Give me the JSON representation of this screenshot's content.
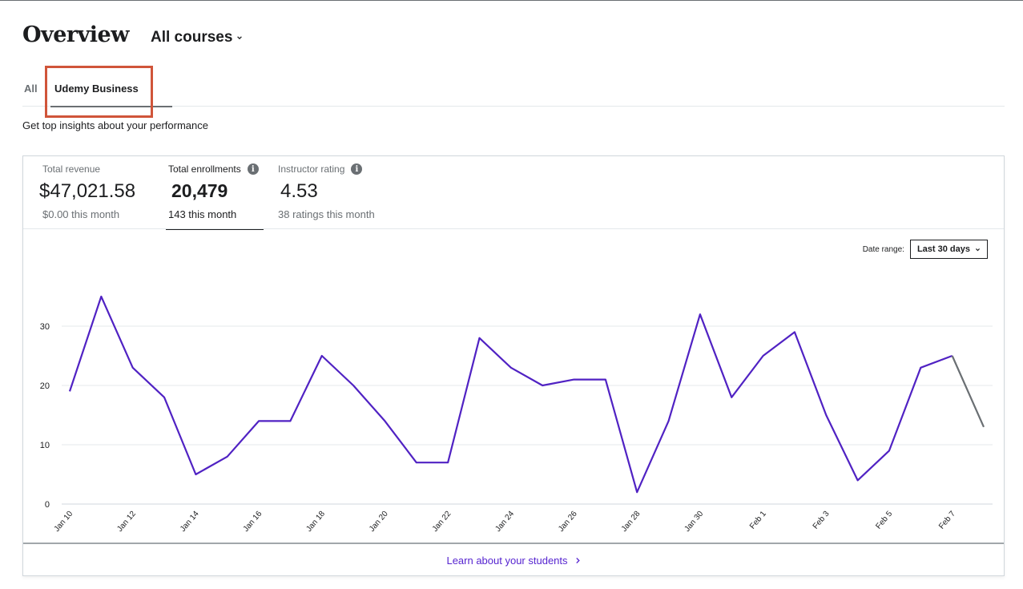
{
  "header": {
    "title": "Overview",
    "course_selector": "All courses"
  },
  "tabs": [
    {
      "label": "All"
    },
    {
      "label": "Udemy Business"
    }
  ],
  "subtitle": "Get top insights about your performance",
  "metrics": [
    {
      "label": "Total revenue",
      "value": "$47,021.58",
      "sub": "$0.00 this month"
    },
    {
      "label": "Total enrollments",
      "value": "20,479",
      "sub": "143 this month"
    },
    {
      "label": "Instructor rating",
      "value": "4.53",
      "sub": "38 ratings this month"
    }
  ],
  "date_range": {
    "label": "Date range:",
    "value": "Last 30 days"
  },
  "footer": {
    "link": "Learn about your students"
  },
  "colors": {
    "line": "#5022c3",
    "line_partial": "#6a6f73",
    "highlight": "#d0553a",
    "link": "#5624d0"
  },
  "icons": [
    "chevron-down-icon",
    "info-icon",
    "chevron-right-icon"
  ],
  "chart_data": {
    "type": "line",
    "x": [
      "Jan 10",
      "Jan 11",
      "Jan 12",
      "Jan 13",
      "Jan 14",
      "Jan 15",
      "Jan 16",
      "Jan 17",
      "Jan 18",
      "Jan 19",
      "Jan 20",
      "Jan 21",
      "Jan 22",
      "Jan 23",
      "Jan 24",
      "Jan 25",
      "Jan 26",
      "Jan 27",
      "Jan 28",
      "Jan 29",
      "Jan 30",
      "Jan 31",
      "Feb 1",
      "Feb 2",
      "Feb 3",
      "Feb 4",
      "Feb 5",
      "Feb 6",
      "Feb 7",
      "Feb 8"
    ],
    "values": [
      19,
      35,
      23,
      18,
      5,
      8,
      14,
      14,
      25,
      20,
      14,
      7,
      7,
      28,
      23,
      20,
      21,
      21,
      2,
      14,
      32,
      18,
      25,
      29,
      15,
      4,
      9,
      23,
      25,
      13
    ],
    "partial_last_segment": true,
    "x_tick_labels": [
      "Jan 10",
      "Jan 12",
      "Jan 14",
      "Jan 16",
      "Jan 18",
      "Jan 20",
      "Jan 22",
      "Jan 24",
      "Jan 26",
      "Jan 28",
      "Jan 30",
      "Feb 1",
      "Feb 3",
      "Feb 5",
      "Feb 7"
    ],
    "y_ticks": [
      0,
      10,
      20,
      30
    ],
    "ylim": [
      0,
      30
    ],
    "grid": true
  }
}
